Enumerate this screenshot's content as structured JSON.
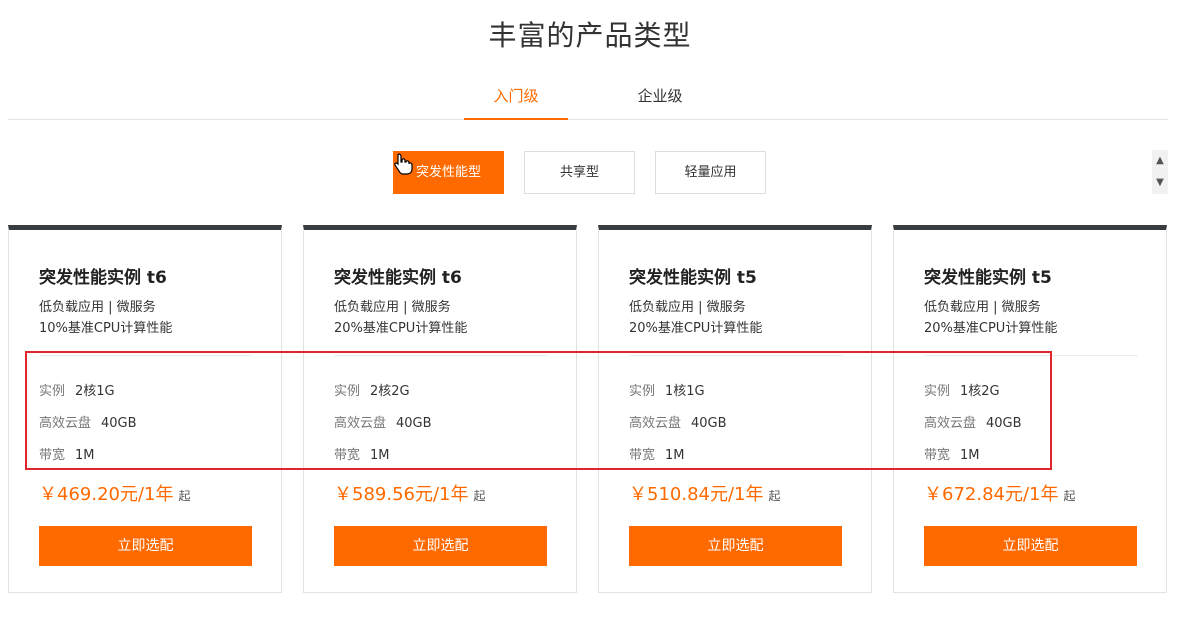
{
  "page": {
    "title": "丰富的产品类型"
  },
  "tabs": [
    {
      "label": "入门级",
      "active": true
    },
    {
      "label": "企业级",
      "active": false
    }
  ],
  "filters": [
    {
      "label": "突发性能型",
      "active": true
    },
    {
      "label": "共享型",
      "active": false
    },
    {
      "label": "轻量应用",
      "active": false
    }
  ],
  "scroller": {
    "up": "▲",
    "down": "▼"
  },
  "cards": [
    {
      "title": "突发性能实例 t6",
      "line1": "低负载应用 | 微服务",
      "line2": "10%基准CPU计算性能",
      "specs": [
        {
          "key": "实例",
          "value": "2核1G"
        },
        {
          "key": "高效云盘",
          "value": "40GB"
        },
        {
          "key": "带宽",
          "value": "1M"
        }
      ],
      "price": "￥469.20元/1年",
      "price_suffix": "起",
      "button": "立即选配"
    },
    {
      "title": "突发性能实例 t6",
      "line1": "低负载应用 | 微服务",
      "line2": "20%基准CPU计算性能",
      "specs": [
        {
          "key": "实例",
          "value": "2核2G"
        },
        {
          "key": "高效云盘",
          "value": "40GB"
        },
        {
          "key": "带宽",
          "value": "1M"
        }
      ],
      "price": "￥589.56元/1年",
      "price_suffix": "起",
      "button": "立即选配"
    },
    {
      "title": "突发性能实例 t5",
      "line1": "低负载应用 | 微服务",
      "line2": "20%基准CPU计算性能",
      "specs": [
        {
          "key": "实例",
          "value": "1核1G"
        },
        {
          "key": "高效云盘",
          "value": "40GB"
        },
        {
          "key": "带宽",
          "value": "1M"
        }
      ],
      "price": "￥510.84元/1年",
      "price_suffix": "起",
      "button": "立即选配"
    },
    {
      "title": "突发性能实例 t5",
      "line1": "低负载应用 | 微服务",
      "line2": "20%基准CPU计算性能",
      "specs": [
        {
          "key": "实例",
          "value": "1核2G"
        },
        {
          "key": "高效云盘",
          "value": "40GB"
        },
        {
          "key": "带宽",
          "value": "1M"
        }
      ],
      "price": "￥672.84元/1年",
      "price_suffix": "起",
      "button": "立即选配"
    }
  ],
  "colors": {
    "accent": "#ff6a00",
    "card_top_border": "#373d41",
    "highlight": "#e0262d"
  },
  "icons": {
    "cursor": "hand-pointer-icon"
  }
}
